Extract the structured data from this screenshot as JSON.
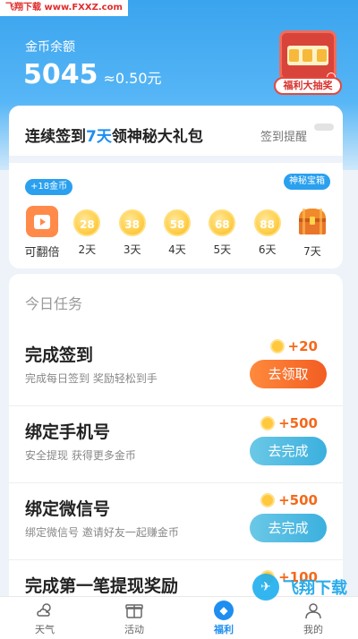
{
  "watermark": "飞翔下载 www.FXXZ.com",
  "wallet": {
    "label": "金币余额",
    "coins": "5045",
    "rmb": "≈0.50元"
  },
  "lottery": {
    "tag": "福利大抽奖",
    "icon": "slot-machine-icon"
  },
  "signin": {
    "title_pre": "连续签到",
    "title_highlight": "7天",
    "title_post": "领神秘大礼包",
    "reminder": "签到提醒",
    "bubble_left": "+18金币",
    "bubble_right": "神秘宝箱",
    "days": [
      {
        "label": "可翻倍",
        "kind": "video"
      },
      {
        "label": "2天",
        "coin": "28"
      },
      {
        "label": "3天",
        "coin": "38"
      },
      {
        "label": "4天",
        "coin": "58"
      },
      {
        "label": "5天",
        "coin": "68"
      },
      {
        "label": "6天",
        "coin": "88"
      },
      {
        "label": "7天",
        "kind": "chest"
      }
    ]
  },
  "tasks": {
    "heading": "今日任务",
    "items": [
      {
        "name": "完成签到",
        "desc": "完成每日签到  奖励轻松到手",
        "reward": "+20",
        "button": "去领取",
        "color": "orange"
      },
      {
        "name": "绑定手机号",
        "desc": "安全提现 获得更多金币",
        "reward": "+500",
        "button": "去完成",
        "color": "blue"
      },
      {
        "name": "绑定微信号",
        "desc": "绑定微信号 邀请好友一起赚金币",
        "reward": "+500",
        "button": "去完成",
        "color": "blue"
      },
      {
        "name": "完成第一笔提现奖励",
        "desc": "",
        "reward": "+100",
        "button": "",
        "color": ""
      }
    ]
  },
  "tabbar": {
    "tabs": [
      {
        "label": "天气",
        "icon": "weather-icon"
      },
      {
        "label": "活动",
        "icon": "gift-icon"
      },
      {
        "label": "福利",
        "icon": "welfare-icon",
        "active": true
      },
      {
        "label": "我的",
        "icon": "profile-icon"
      }
    ]
  },
  "logo_watermark": "飞翔下载",
  "colors": {
    "primary": "#1e8ef0",
    "accent_orange": "#f25d22",
    "coin_gold": "#ffcf4b"
  }
}
